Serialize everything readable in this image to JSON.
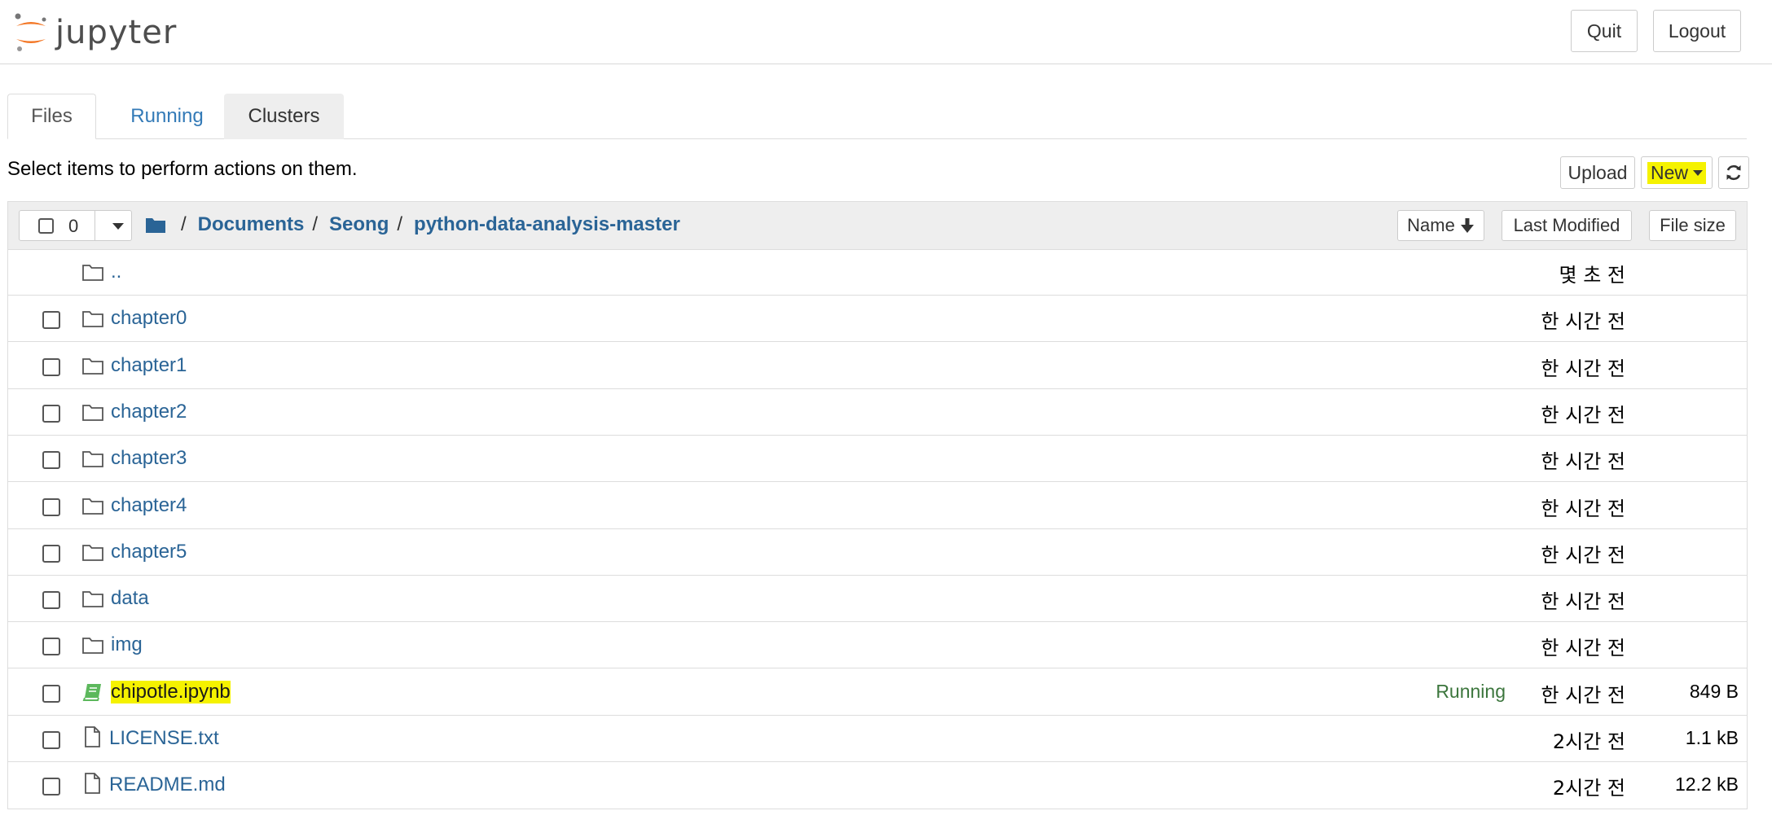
{
  "header": {
    "logo_text": "jupyter",
    "quit_label": "Quit",
    "logout_label": "Logout"
  },
  "tabs": [
    {
      "label": "Files",
      "state": "active"
    },
    {
      "label": "Running",
      "state": "link"
    },
    {
      "label": "Clusters",
      "state": "gray"
    }
  ],
  "toolbar": {
    "hint": "Select items to perform actions on them.",
    "upload_label": "Upload",
    "new_label": "New"
  },
  "list_header": {
    "selected_count": "0",
    "breadcrumb": [
      "Documents",
      "Seong",
      "python-data-analysis-master"
    ],
    "sort_name_label": "Name",
    "sort_modified_label": "Last Modified",
    "sort_size_label": "File size"
  },
  "rows": [
    {
      "name": "..",
      "type": "folder",
      "modified": "몇 초 전",
      "size": "",
      "status": "",
      "checkbox": false
    },
    {
      "name": "chapter0",
      "type": "folder",
      "modified": "한 시간 전",
      "size": "",
      "status": "",
      "checkbox": true
    },
    {
      "name": "chapter1",
      "type": "folder",
      "modified": "한 시간 전",
      "size": "",
      "status": "",
      "checkbox": true
    },
    {
      "name": "chapter2",
      "type": "folder",
      "modified": "한 시간 전",
      "size": "",
      "status": "",
      "checkbox": true
    },
    {
      "name": "chapter3",
      "type": "folder",
      "modified": "한 시간 전",
      "size": "",
      "status": "",
      "checkbox": true
    },
    {
      "name": "chapter4",
      "type": "folder",
      "modified": "한 시간 전",
      "size": "",
      "status": "",
      "checkbox": true
    },
    {
      "name": "chapter5",
      "type": "folder",
      "modified": "한 시간 전",
      "size": "",
      "status": "",
      "checkbox": true
    },
    {
      "name": "data",
      "type": "folder",
      "modified": "한 시간 전",
      "size": "",
      "status": "",
      "checkbox": true
    },
    {
      "name": "img",
      "type": "folder",
      "modified": "한 시간 전",
      "size": "",
      "status": "",
      "checkbox": true
    },
    {
      "name": "chipotle.ipynb",
      "type": "notebook",
      "modified": "한 시간 전",
      "size": "849 B",
      "status": "Running",
      "checkbox": true,
      "highlighted": true
    },
    {
      "name": "LICENSE.txt",
      "type": "file",
      "modified": "2시간 전",
      "size": "1.1 kB",
      "status": "",
      "checkbox": true
    },
    {
      "name": "README.md",
      "type": "file",
      "modified": "2시간 전",
      "size": "12.2 kB",
      "status": "",
      "checkbox": true
    }
  ],
  "colors": {
    "link": "#2a6496",
    "highlight": "#f5f200",
    "running": "#3c763d",
    "logo_orange": "#f37726",
    "notebook_green": "#5cb85c"
  }
}
